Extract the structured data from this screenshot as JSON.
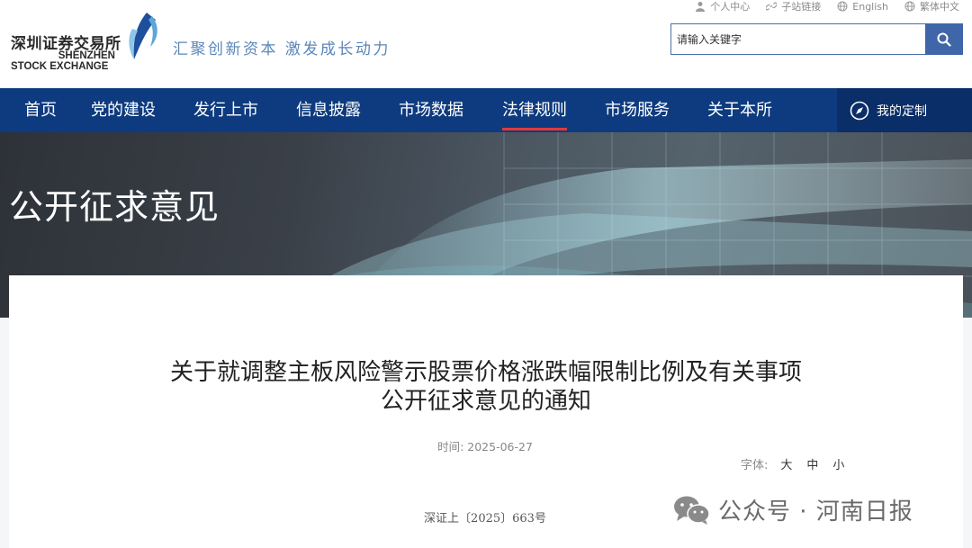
{
  "header": {
    "logo_cn": "深圳证券交易所",
    "logo_en_line1": "SHENZHEN",
    "logo_en_line2": "STOCK EXCHANGE",
    "slogan": "汇聚创新资本 激发成长动力",
    "toplinks": [
      {
        "label": "个人中心",
        "icon": "person-icon"
      },
      {
        "label": "子站链接",
        "icon": "link-icon"
      },
      {
        "label": "English",
        "icon": "globe-icon"
      },
      {
        "label": "繁体中文",
        "icon": "globe-icon"
      }
    ],
    "search": {
      "placeholder": "请输入关键字"
    }
  },
  "nav": {
    "items": [
      "首页",
      "党的建设",
      "发行上市",
      "信息披露",
      "市场数据",
      "法律规则",
      "市场服务",
      "关于本所"
    ],
    "active": "法律规则",
    "custom_label": "我的定制"
  },
  "banner": {
    "title": "公开征求意见"
  },
  "article": {
    "title_line1": "关于就调整主板风险警示股票价格涨跌幅限制比例及有关事项",
    "title_line2": "公开征求意见的通知",
    "time_label": "时间:",
    "time_value": "2025-06-27",
    "font_label": "字体:",
    "font_options": [
      "大",
      "中",
      "小"
    ],
    "doc_number": "深证上〔2025〕663号"
  },
  "watermark": {
    "text": "公众号 · 河南日报"
  },
  "colors": {
    "nav_bg": "#0e3b7f",
    "accent": "#e2393b",
    "search_btn": "#3f66a8",
    "slogan": "#5b86b8"
  }
}
